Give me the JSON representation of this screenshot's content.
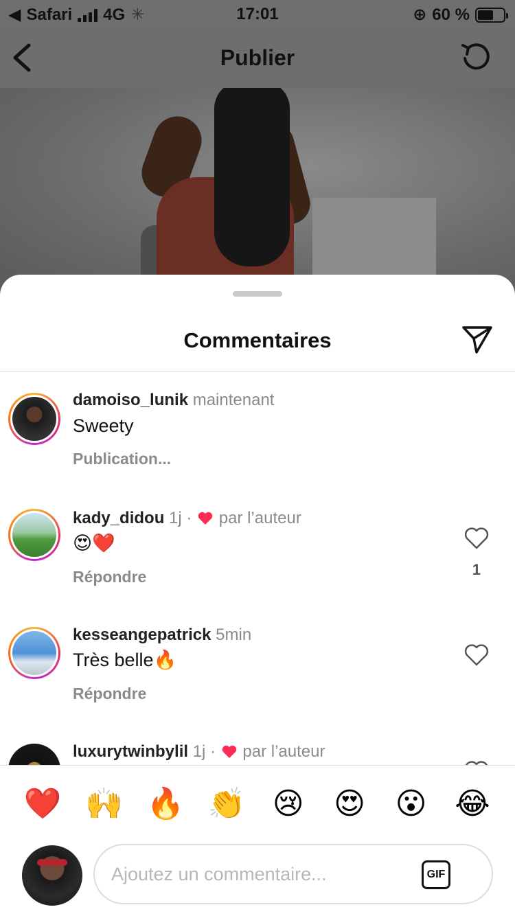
{
  "status_bar": {
    "carrier": "Safari",
    "network": "4G",
    "time": "17:01",
    "battery": "60 %",
    "battery_level": 0.6
  },
  "nav": {
    "title": "Publier"
  },
  "sheet": {
    "title": "Commentaires"
  },
  "comments": [
    {
      "username": "damoiso_lunik",
      "time": "maintenant",
      "text": "Sweety",
      "action": "Publication..."
    },
    {
      "username": "kady_didou",
      "time": "1j",
      "liked_by_author": "par l’auteur",
      "text": "😍❤️",
      "action": "Répondre",
      "likes": "1"
    },
    {
      "username": "kesseangepatrick",
      "time": "5min",
      "text": "Très belle🔥",
      "action": "Répondre"
    },
    {
      "username": "luxurytwinbylil",
      "time": "1j",
      "liked_by_author": "par l’auteur"
    }
  ],
  "emoji_bar": [
    "❤️",
    "🙌",
    "🔥",
    "👏",
    "😢",
    "😍",
    "😮",
    "😂"
  ],
  "composer": {
    "placeholder": "Ajoutez un commentaire...",
    "gif_label": "GIF"
  },
  "colors": {
    "like_red": "#ff2d55",
    "muted_text": "#8a8a8a"
  }
}
